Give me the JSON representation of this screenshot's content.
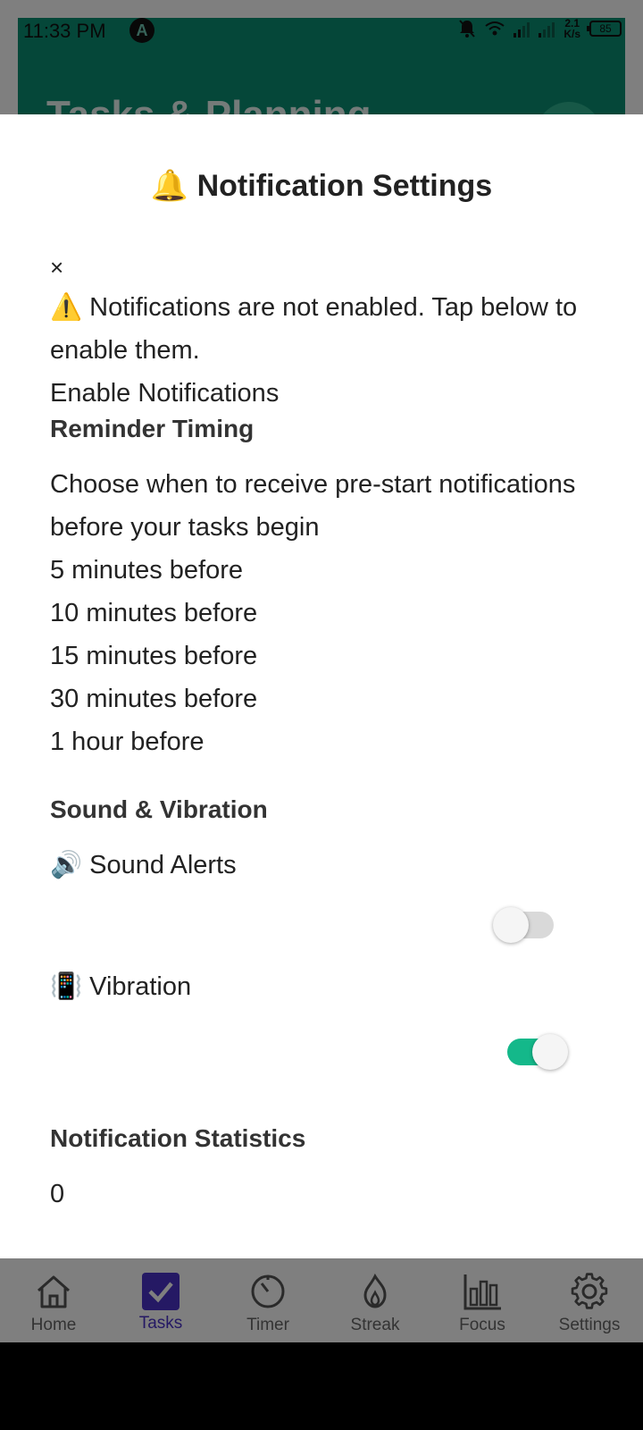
{
  "status_bar": {
    "time": "11:33 PM",
    "app_icon": "A",
    "speed_top": "2.1",
    "speed_bottom": "K/s",
    "battery": "85"
  },
  "background": {
    "header_title": "Tasks & Planning"
  },
  "modal": {
    "title_emoji": "🔔",
    "title": "Notification Settings",
    "close_label": "×",
    "warning_emoji": "⚠️",
    "warning_text": "Notifications are not enabled. Tap below to enable them.",
    "enable_button": "Enable Notifications",
    "reminder": {
      "heading": "Reminder Timing",
      "description": "Choose when to receive pre-start notifications before your tasks begin",
      "options": [
        "5 minutes before",
        "10 minutes before",
        "15 minutes before",
        "30 minutes before",
        "1 hour before"
      ]
    },
    "sound_vibration": {
      "heading": "Sound & Vibration",
      "sound_emoji": "🔊",
      "sound_label": "Sound Alerts",
      "sound_enabled": false,
      "vibration_emoji": "📳",
      "vibration_label": "Vibration",
      "vibration_enabled": true
    },
    "statistics": {
      "heading": "Notification Statistics",
      "value": "0"
    }
  },
  "bottom_nav": {
    "items": [
      {
        "label": "Home",
        "icon": "home-icon"
      },
      {
        "label": "Tasks",
        "icon": "tasks-check-icon",
        "active": true
      },
      {
        "label": "Timer",
        "icon": "timer-icon"
      },
      {
        "label": "Streak",
        "icon": "flame-icon"
      },
      {
        "label": "Focus",
        "icon": "bar-chart-icon"
      },
      {
        "label": "Settings",
        "icon": "gear-icon"
      }
    ]
  },
  "colors": {
    "header_green": "#0a8f72",
    "toggle_on": "#14b88a",
    "toggle_off": "#d9d9d9",
    "nav_active": "#4a33c8"
  }
}
